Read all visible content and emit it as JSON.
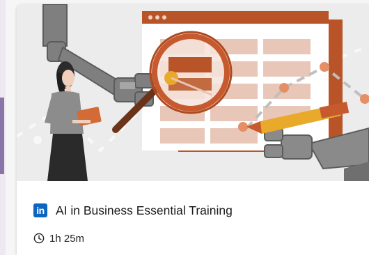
{
  "card": {
    "provider_icon": "linkedin-icon",
    "provider_icon_text": "in",
    "title": "AI in Business Essential Training",
    "duration_icon": "clock-icon",
    "duration": "1h 25m"
  },
  "colors": {
    "linkedin_blue": "#0a66c2",
    "illustration_orange": "#c65a2e",
    "illustration_peach": "#e8c4b3",
    "robot_gray": "#8a8a8a",
    "pen_yellow": "#e9a92b",
    "background_gray": "#ececec",
    "previous_card_accent": "#8a74a8"
  }
}
